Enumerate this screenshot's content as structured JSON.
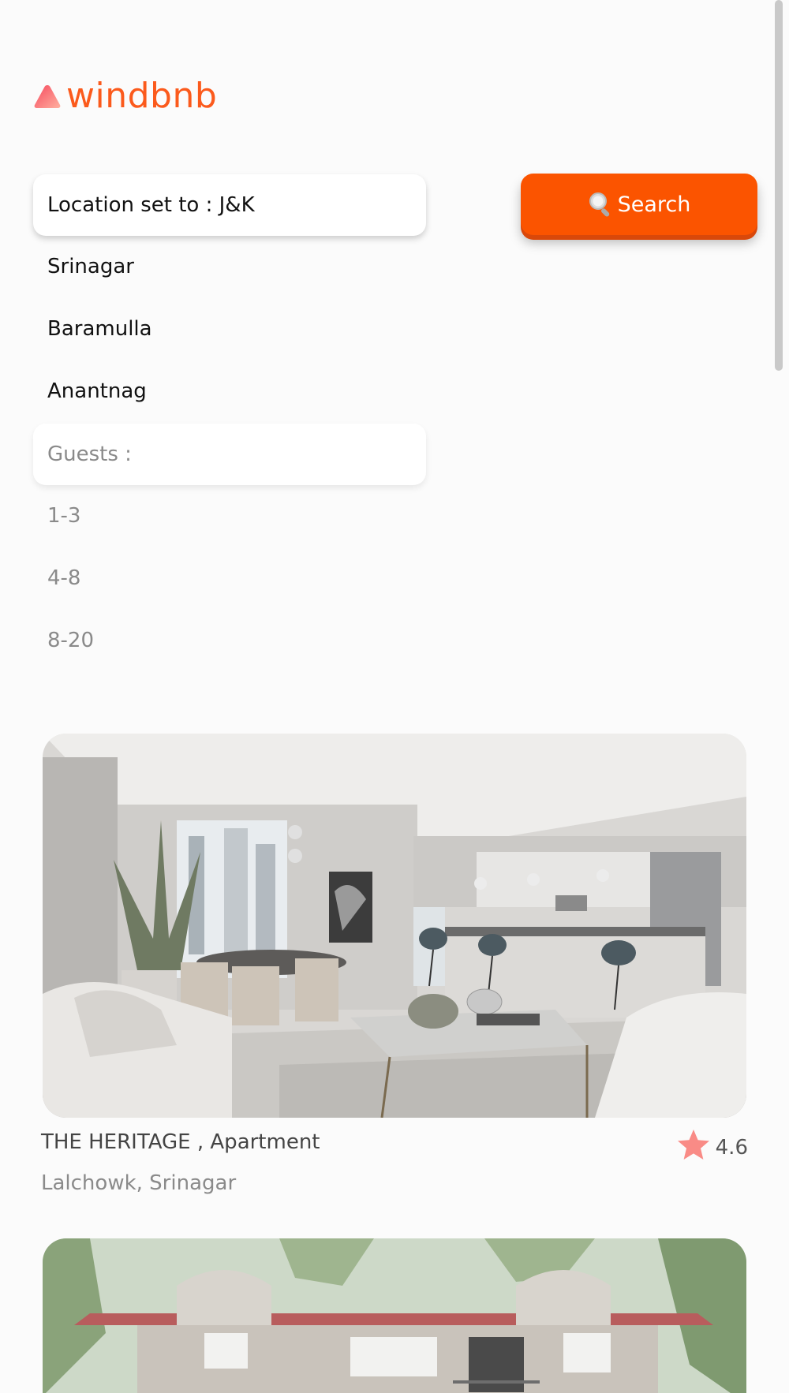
{
  "brand": {
    "name": "windbnb",
    "color": "#fb5a1c"
  },
  "search": {
    "location_label": "Location set to : J&K",
    "locations": [
      "Srinagar",
      "Baramulla",
      "Anantnag"
    ],
    "guests_label": "Guests :",
    "guest_options": [
      "1-3",
      "4-8",
      "8-20"
    ],
    "button_label": "Search",
    "button_icon": "magnifier-icon",
    "button_color": "#fb5400"
  },
  "listings": [
    {
      "title": "THE HERITAGE , Apartment",
      "location": "Lalchowk, Srinagar",
      "rating": "4.6",
      "image": "living-room-kitchen-photo"
    },
    {
      "image": "house-exterior-photo"
    }
  ]
}
